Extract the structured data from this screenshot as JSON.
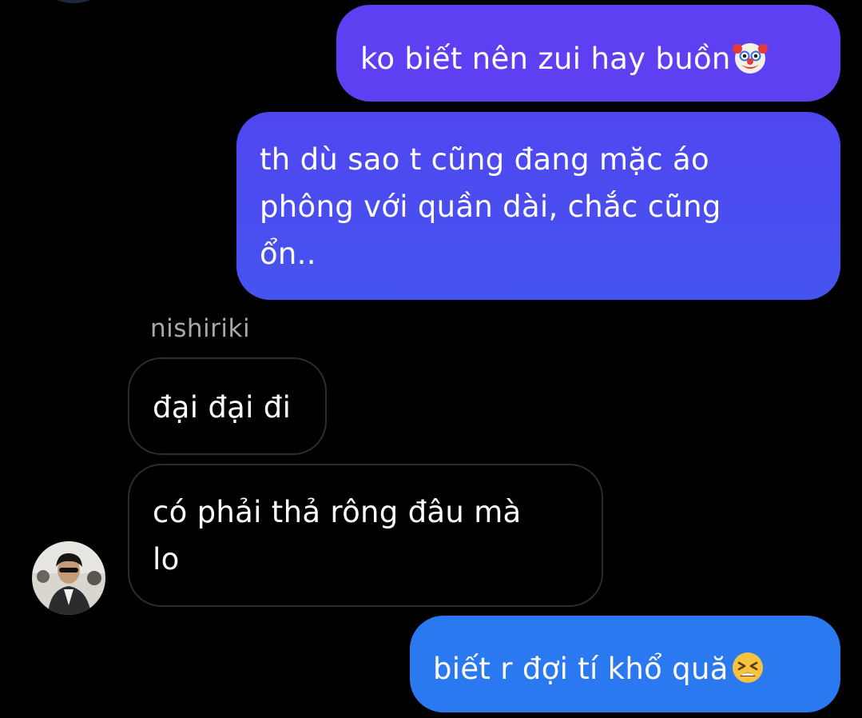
{
  "thread": {
    "sender_name": "nishiriki",
    "messages": [
      {
        "direction": "outgoing",
        "text": "ko biết nên zui hay buồn",
        "emoji": "clown-face"
      },
      {
        "direction": "outgoing",
        "lines": [
          "th dù sao t cũng đang mặc áo",
          "phông với quần dài, chắc cũng",
          "ổn.."
        ]
      },
      {
        "direction": "incoming",
        "text": "đại đại đi"
      },
      {
        "direction": "incoming",
        "lines": [
          "có phải thả rông đâu mà",
          "lo"
        ]
      },
      {
        "direction": "outgoing",
        "text": "biết r đợi tí khổ quă",
        "emoji": "tired-face"
      }
    ]
  },
  "colors": {
    "background": "#000000",
    "sent_gradient_top": "#5f3ef2",
    "sent_gradient_mid": "#4657ef",
    "sent_gradient_bottom": "#2b78f0",
    "received_border": "#2c2c2e",
    "sender_name": "#a8a8a8"
  }
}
